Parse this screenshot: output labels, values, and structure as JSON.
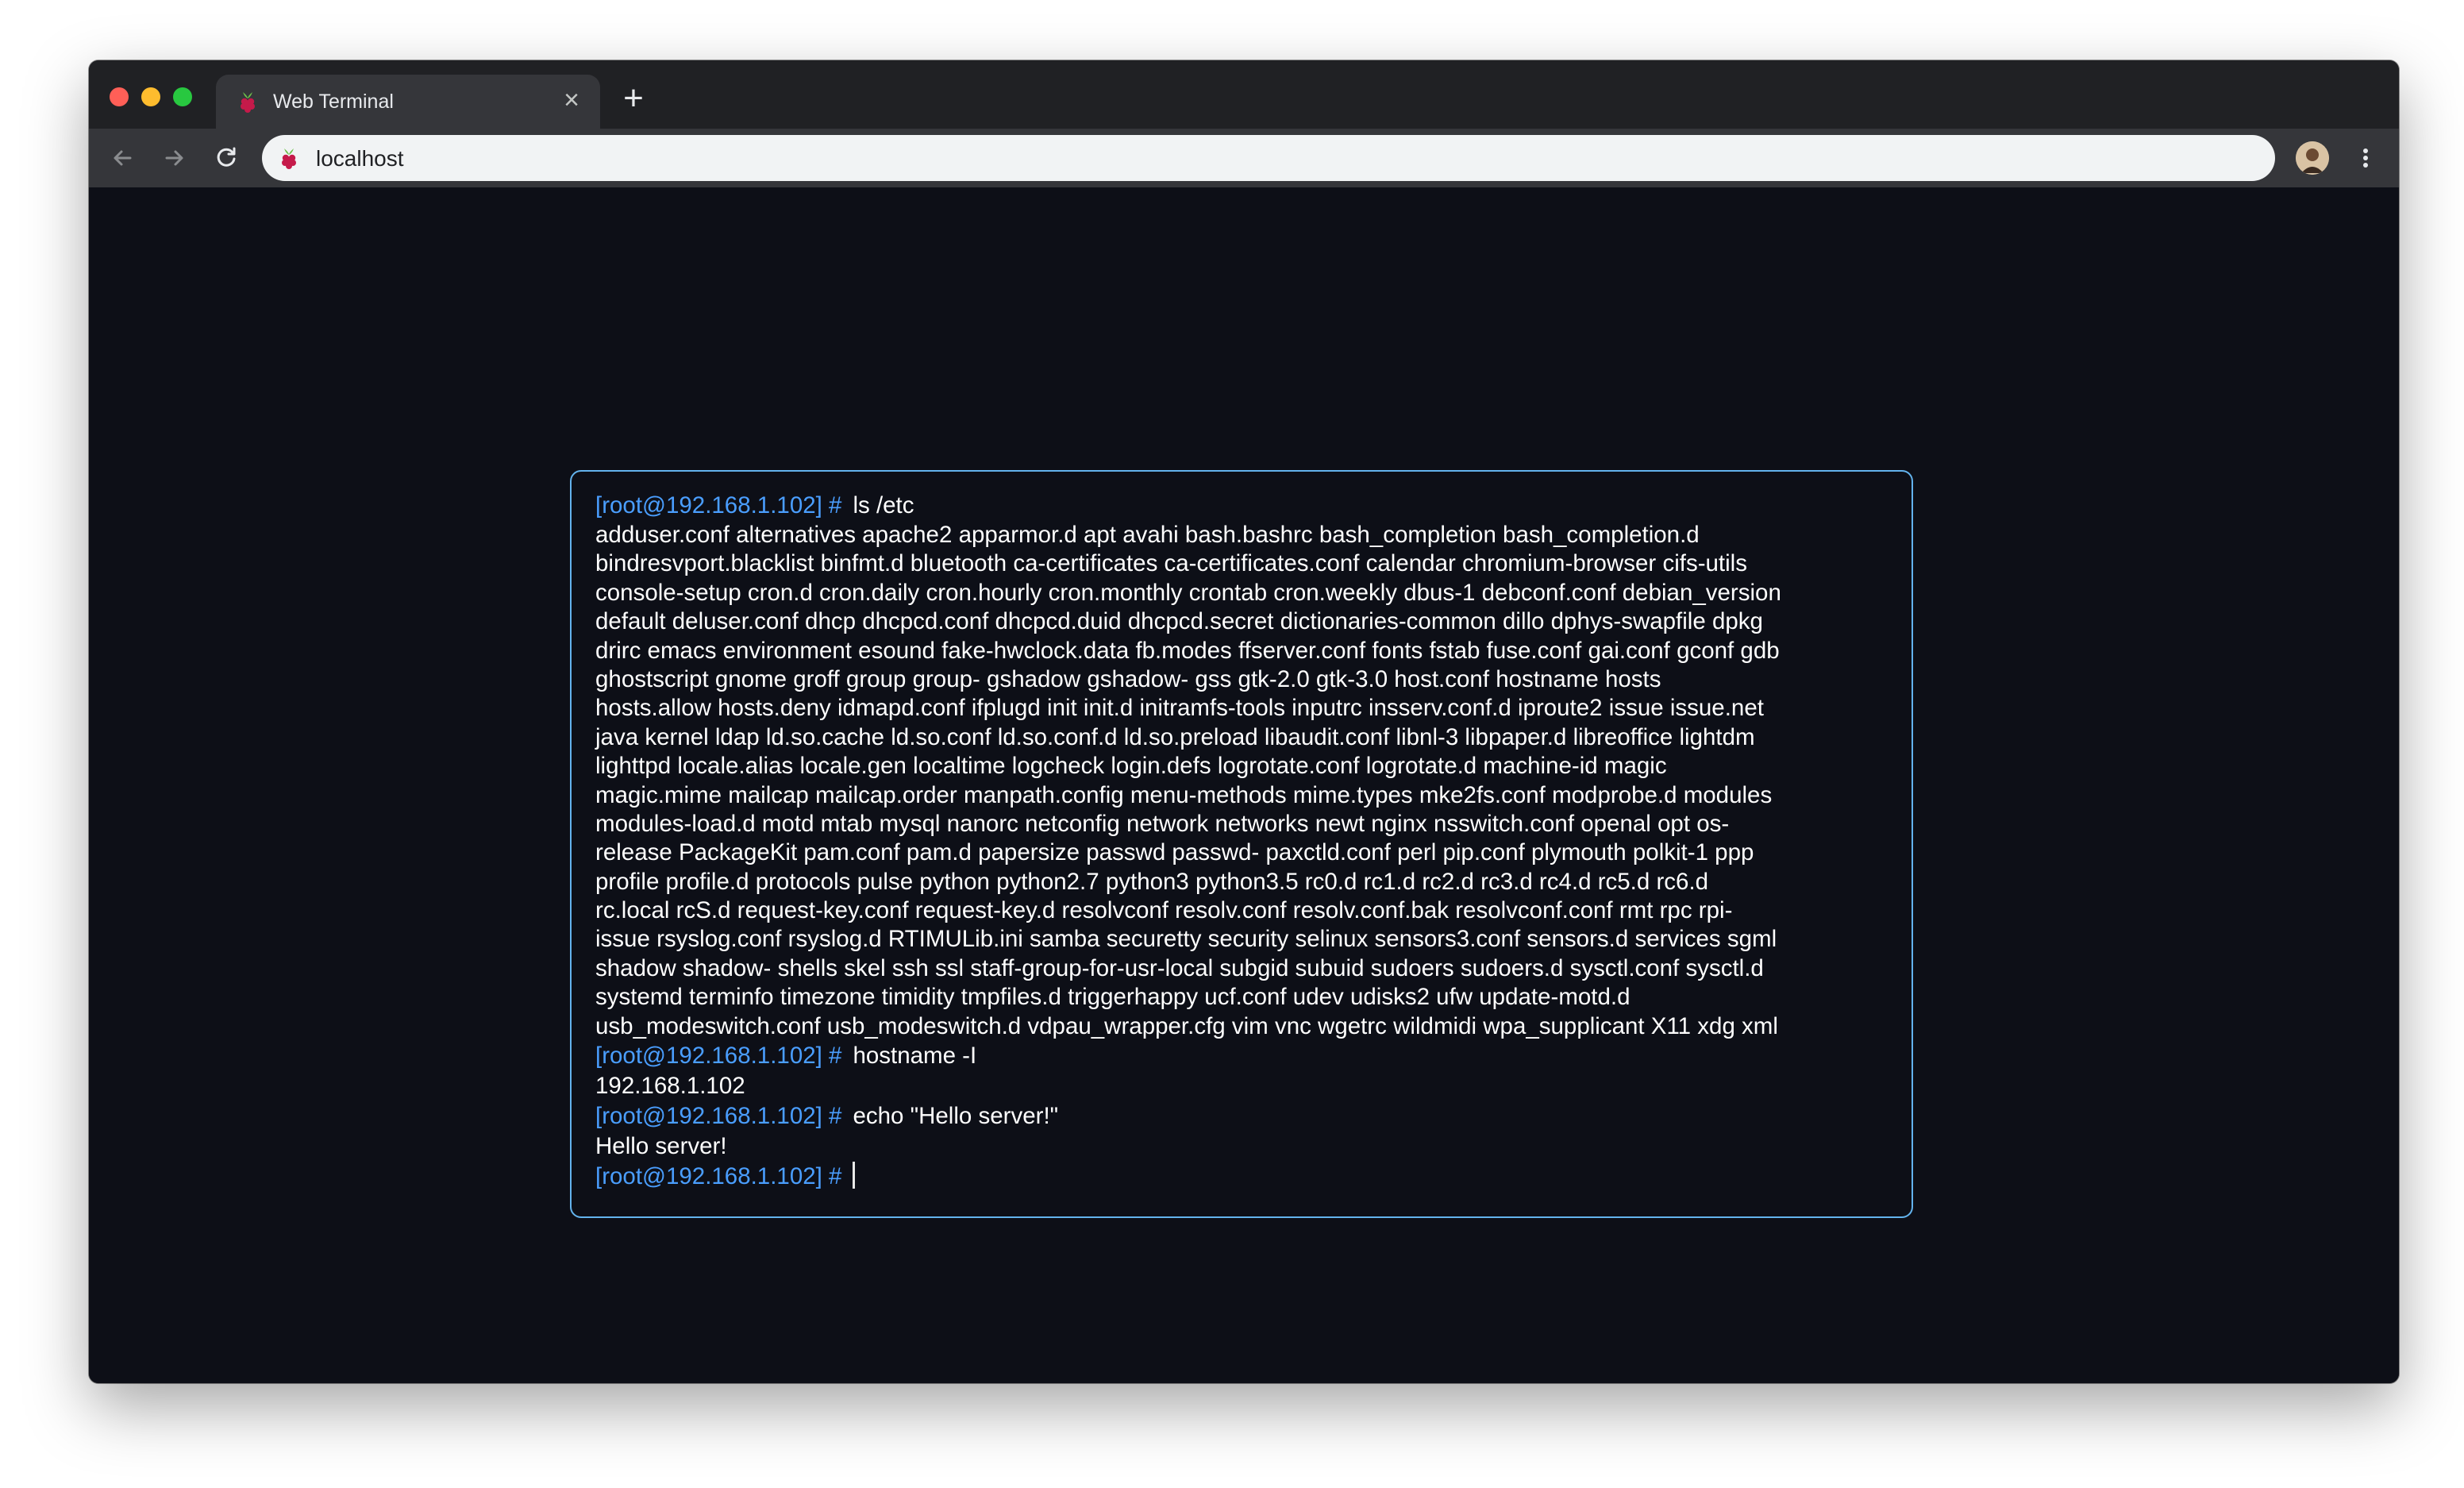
{
  "browser": {
    "tab_title": "Web Terminal",
    "tab_close": "×",
    "new_tab": "+",
    "url": "localhost"
  },
  "terminal": {
    "prompt": "[root@192.168.1.102] #",
    "entries": [
      {
        "command": "ls /etc",
        "output": [
          "adduser.conf alternatives apache2 apparmor.d apt avahi bash.bashrc bash_completion bash_completion.d",
          "bindresvport.blacklist binfmt.d bluetooth ca-certificates ca-certificates.conf calendar chromium-browser cifs-utils",
          "console-setup cron.d cron.daily cron.hourly cron.monthly crontab cron.weekly dbus-1 debconf.conf debian_version",
          "default deluser.conf dhcp dhcpcd.conf dhcpcd.duid dhcpcd.secret dictionaries-common dillo dphys-swapfile dpkg",
          "drirc emacs environment esound fake-hwclock.data fb.modes ffserver.conf fonts fstab fuse.conf gai.conf gconf gdb",
          "ghostscript gnome groff group group- gshadow gshadow- gss gtk-2.0 gtk-3.0 host.conf hostname hosts",
          "hosts.allow hosts.deny idmapd.conf ifplugd init init.d initramfs-tools inputrc insserv.conf.d iproute2 issue issue.net",
          "java kernel ldap ld.so.cache ld.so.conf ld.so.conf.d ld.so.preload libaudit.conf libnl-3 libpaper.d libreoffice lightdm",
          "lighttpd locale.alias locale.gen localtime logcheck login.defs logrotate.conf logrotate.d machine-id magic",
          "magic.mime mailcap mailcap.order manpath.config menu-methods mime.types mke2fs.conf modprobe.d modules",
          "modules-load.d motd mtab mysql nanorc netconfig network networks newt nginx nsswitch.conf openal opt os-",
          "release PackageKit pam.conf pam.d papersize passwd passwd- paxctld.conf perl pip.conf plymouth polkit-1 ppp",
          "profile profile.d protocols pulse python python2.7 python3 python3.5 rc0.d rc1.d rc2.d rc3.d rc4.d rc5.d rc6.d",
          "rc.local rcS.d request-key.conf request-key.d resolvconf resolv.conf resolv.conf.bak resolvconf.conf rmt rpc rpi-",
          "issue rsyslog.conf rsyslog.d RTIMULib.ini samba securetty security selinux sensors3.conf sensors.d services sgml",
          "shadow shadow- shells skel ssh ssl staff-group-for-usr-local subgid subuid sudoers sudoers.d sysctl.conf sysctl.d",
          "systemd terminfo timezone timidity tmpfiles.d triggerhappy ucf.conf udev udisks2 ufw update-motd.d",
          "usb_modeswitch.conf usb_modeswitch.d vdpau_wrapper.cfg vim vnc wgetrc wildmidi wpa_supplicant X11 xdg xml"
        ]
      },
      {
        "command": "hostname -I",
        "output": [
          "192.168.1.102"
        ]
      },
      {
        "command": "echo \"Hello server!\"",
        "output": [
          "Hello server!"
        ]
      }
    ]
  },
  "colors": {
    "page_bg": "#0d0f17",
    "terminal_border": "#63b3ed",
    "prompt": "#4a9eff",
    "text": "#ffffff"
  },
  "icons": [
    "raspberry-favicon-icon",
    "back-icon",
    "forward-icon",
    "reload-icon",
    "profile-avatar-icon",
    "more-menu-icon",
    "close-icon",
    "new-tab-icon"
  ]
}
